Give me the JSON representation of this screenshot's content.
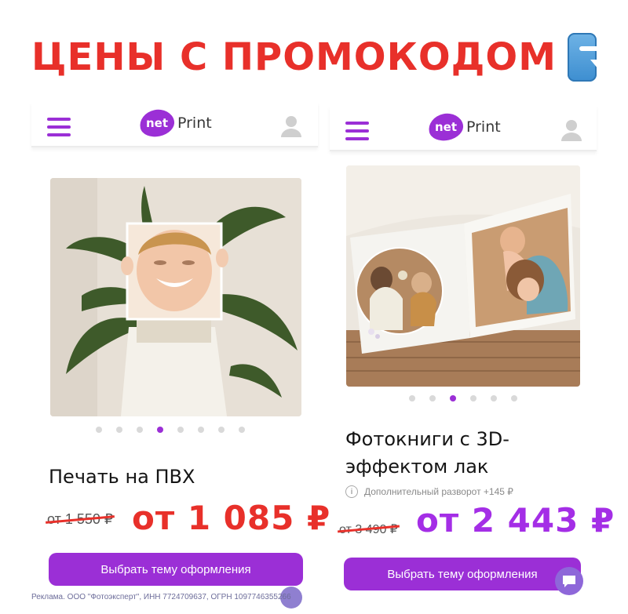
{
  "headline": {
    "text": "ЦЕНЫ С ПРОМОКОДОМ",
    "icon": "arrow-turn-down-icon"
  },
  "brand": {
    "badge": "net",
    "word": "Print",
    "accent_color": "#9b2fd6",
    "promo_color": "#e8302a"
  },
  "left_card": {
    "title": "Печать на ПВХ",
    "old_price": "от 1 550 ₽",
    "new_price": "от 1 085 ₽",
    "cta_label": "Выбрать тему оформления",
    "carousel": {
      "count": 8,
      "active": 4
    },
    "image": "child-holding-photo-print"
  },
  "right_card": {
    "title_line1": "Фотокниги с 3D-",
    "title_line2": "эффектом лак",
    "extra_spread": "Дополнительный разворот +145 ₽",
    "old_price": "от 3 490 ₽",
    "new_price": "от 2 443 ₽",
    "cta_label": "Выбрать тему оформления",
    "carousel": {
      "count": 6,
      "active": 3
    },
    "image": "open-photobook"
  },
  "disclaimer": "Реклама. ООО \"Фотоэксперт\", ИНН 7724709637, ОГРН 1097746355266"
}
